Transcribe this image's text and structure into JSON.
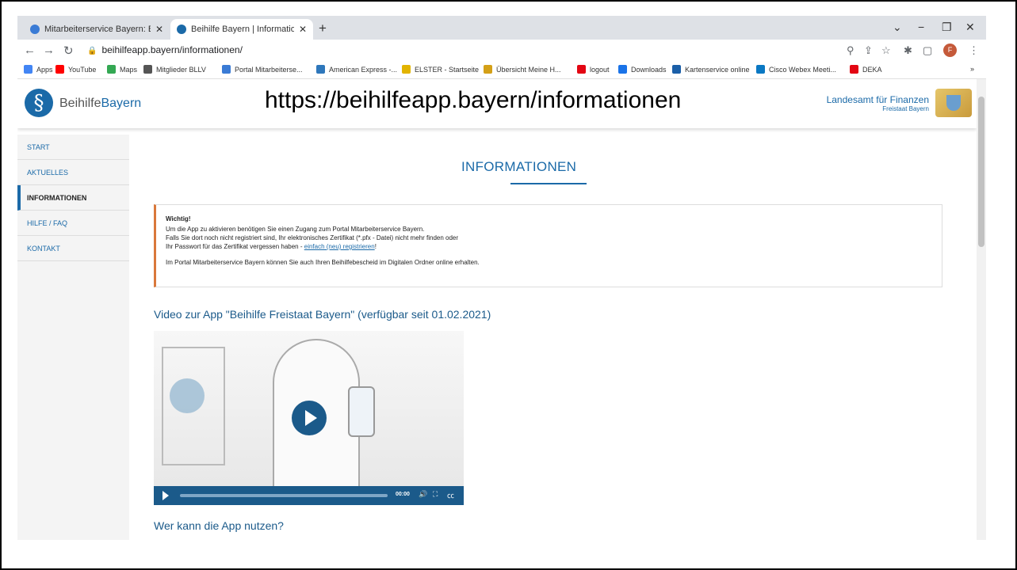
{
  "browser": {
    "tabs": [
      {
        "label": "Mitarbeiterservice Bayern: Beihilf",
        "color": "#3a7bd5"
      },
      {
        "label": "Beihilfe Bayern | Informationen",
        "color": "#1b6aa8"
      }
    ],
    "new_tab": "+",
    "window_controls": {
      "minimize": "−",
      "restore": "❐",
      "close": "✕",
      "tabsearch": "⌄"
    },
    "url": "beihilfeapp.bayern/informationen/",
    "avatar_letter": "F",
    "bookmarks": [
      {
        "label": "Apps",
        "color": "#4285f4"
      },
      {
        "label": "YouTube",
        "color": "#ff0000"
      },
      {
        "label": "Maps",
        "color": "#34a853"
      },
      {
        "label": "Mitglieder BLLV",
        "color": "#555555"
      },
      {
        "label": "Portal Mitarbeiterse...",
        "color": "#3a7bd5"
      },
      {
        "label": "American Express -...",
        "color": "#2e77bb"
      },
      {
        "label": "ELSTER - Startseite",
        "color": "#e2b400"
      },
      {
        "label": "Übersicht Meine H...",
        "color": "#d4a017"
      },
      {
        "label": "logout",
        "color": "#e30613"
      },
      {
        "label": "Downloads",
        "color": "#1a73e8"
      },
      {
        "label": "Kartenservice online",
        "color": "#1b5fa8"
      },
      {
        "label": "Cisco Webex Meeti...",
        "color": "#0a78c3"
      },
      {
        "label": "DEKA",
        "color": "#e30613"
      }
    ],
    "bookmarks_more": "»"
  },
  "site": {
    "brand_part1": "Beihilfe",
    "brand_part2": "Bayern",
    "overlay_url": "https://beihilfeapp.bayern/informationen",
    "lff_line1": "Landesamt für Finanzen",
    "lff_line2": "Freistaat Bayern"
  },
  "sidebar": {
    "items": [
      {
        "label": "START",
        "active": false
      },
      {
        "label": "AKTUELLES",
        "active": false
      },
      {
        "label": "INFORMATIONEN",
        "active": true
      },
      {
        "label": "HILFE / FAQ",
        "active": false
      },
      {
        "label": "KONTAKT",
        "active": false
      }
    ]
  },
  "main": {
    "heading": "INFORMATIONEN",
    "notice": {
      "title": "Wichtig!",
      "line1": "Um die App zu aktivieren benötigen Sie einen Zugang zum Portal Mitarbeiterservice Bayern.",
      "line2": "Falls Sie dort noch nicht registriert sind, Ihr elektronisches Zertifikat (*.pfx - Datei) nicht mehr finden oder",
      "line3_pre": "Ihr Passwort für das Zertifikat vergessen haben - ",
      "line3_link": "einfach (neu) registrieren",
      "line3_post": "!",
      "line4": "Im Portal Mitarbeiterservice Bayern können Sie auch Ihren Beihilfebescheid im Digitalen Ordner online erhalten."
    },
    "video_title": "Video zur App \"Beihilfe Freistaat Bayern\" (verfügbar seit 01.02.2021)",
    "video_time": "00:00",
    "video_progress": 0,
    "next_heading": "Wer kann die App nutzen?"
  }
}
